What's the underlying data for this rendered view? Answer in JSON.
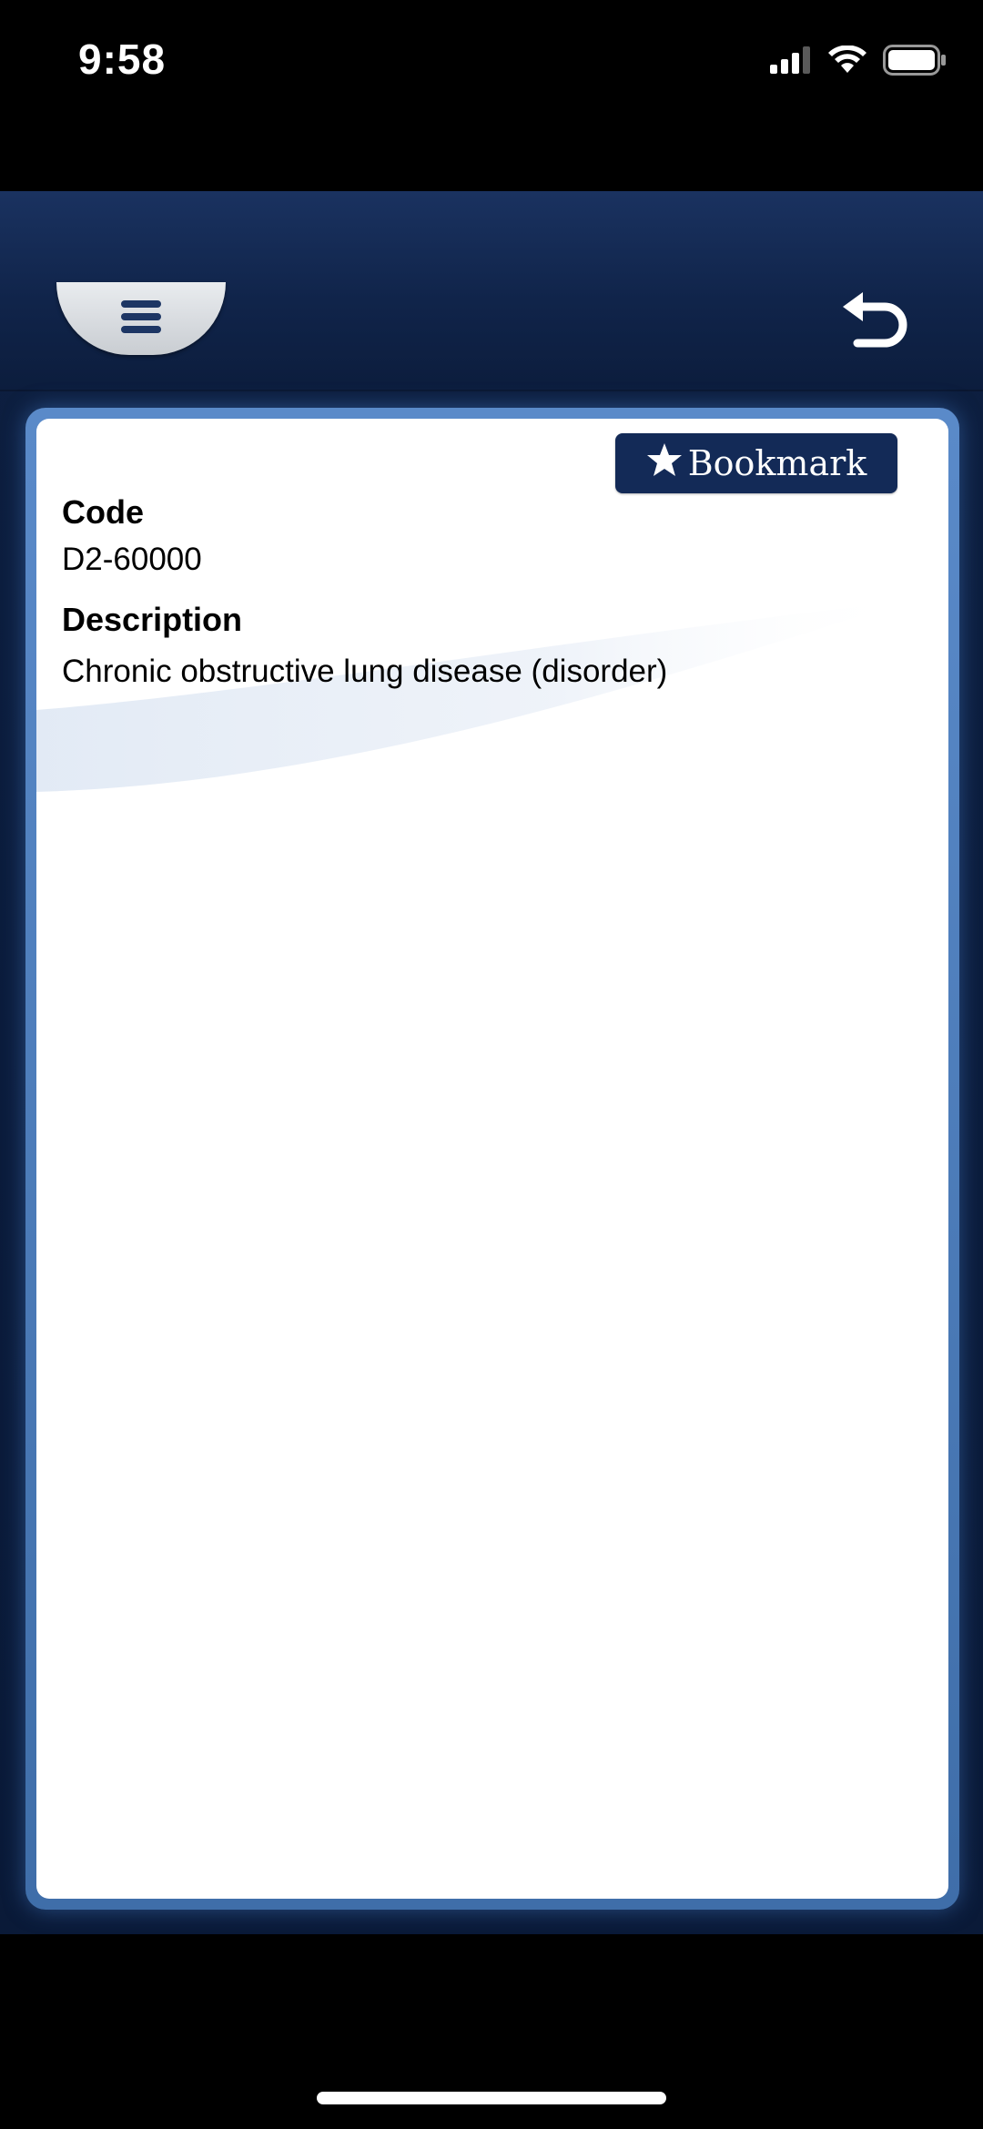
{
  "status_bar": {
    "time": "9:58",
    "icons": [
      "cellular-signal-icon",
      "wifi-icon",
      "battery-icon"
    ]
  },
  "toolbar": {
    "menu_icon": "hamburger-icon",
    "back_icon": "undo-arrow-icon"
  },
  "bookmark": {
    "icon": "star-icon",
    "label": "Bookmark"
  },
  "record": {
    "code_label": "Code",
    "code_value": "D2-60000",
    "description_label": "Description",
    "description_value": "Chronic obstructive lung disease (disorder)"
  },
  "colors": {
    "frame": "#0b1c3c",
    "card_border": "#4f7fbd",
    "bookmark_bg": "#132a57"
  }
}
